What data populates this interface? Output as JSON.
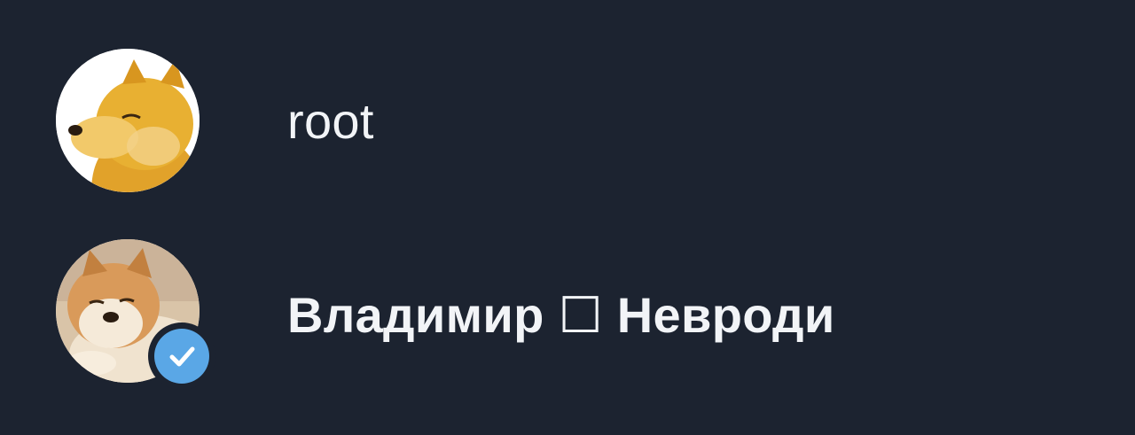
{
  "contacts": [
    {
      "name": "root",
      "avatar": "shiba-dog-avatar-cheems",
      "verified": false
    },
    {
      "name": "Владимир ☐ Невроди",
      "avatar": "shiba-dog-avatar-smug",
      "verified": true
    }
  ],
  "colors": {
    "background": "#1c2330",
    "text": "#f2f4f7",
    "verified_badge": "#5aa7e6"
  }
}
